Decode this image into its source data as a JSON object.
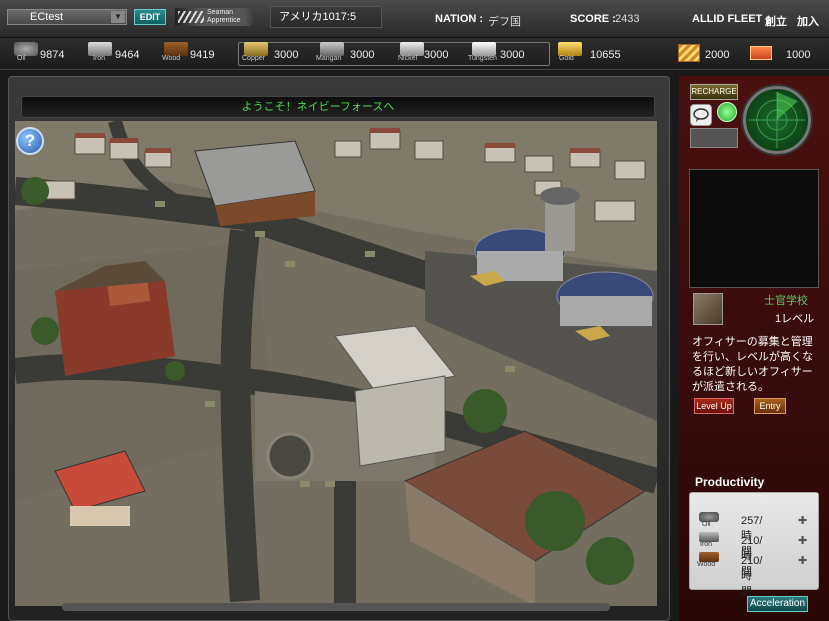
{
  "header": {
    "player_name": "ECtest",
    "edit_label": "EDIT",
    "rank_line1": "Seaman",
    "rank_line2": "Apprentice",
    "location": "アメリカ1017:5",
    "nation_label": "NATION :",
    "nation_value": "デフ国",
    "score_label": "SCORE :",
    "score_value": "2433",
    "fleet_label": "ALLID FLEET :",
    "fleet_create": "創立",
    "fleet_join": "加入"
  },
  "resources": [
    {
      "name": "Oil",
      "value": "9874"
    },
    {
      "name": "Iron",
      "value": "9464"
    },
    {
      "name": "Wood",
      "value": "9419"
    },
    {
      "name": "Copper",
      "value": "3000"
    },
    {
      "name": "Mangan",
      "value": "3000"
    },
    {
      "name": "Nickel",
      "value": "3000"
    },
    {
      "name": "Tungsten",
      "value": "3000"
    },
    {
      "name": "Gold",
      "value": "10655"
    }
  ],
  "currency": {
    "medal_value": "2000",
    "ticket_value": "1000"
  },
  "main": {
    "welcome": "ようこそ！ネイビーフォースへ",
    "help_glyph": "?"
  },
  "side": {
    "recharge_label": "RECHARGE",
    "building_name": "士官学校",
    "building_level": "1レベル",
    "building_desc": "オフィサーの募集と管理を行い、レベルが高くなるほど新しいオフィサーが派遣される。",
    "levelup_label": "Level Up",
    "entry_label": "Entry",
    "productivity_title": "Productivity",
    "productivity": [
      {
        "name": "Oil",
        "value": "257/時間"
      },
      {
        "name": "Iron",
        "value": "210/時間"
      },
      {
        "name": "Wood",
        "value": "210/時間"
      }
    ],
    "acceleration_label": "Acceleration"
  }
}
